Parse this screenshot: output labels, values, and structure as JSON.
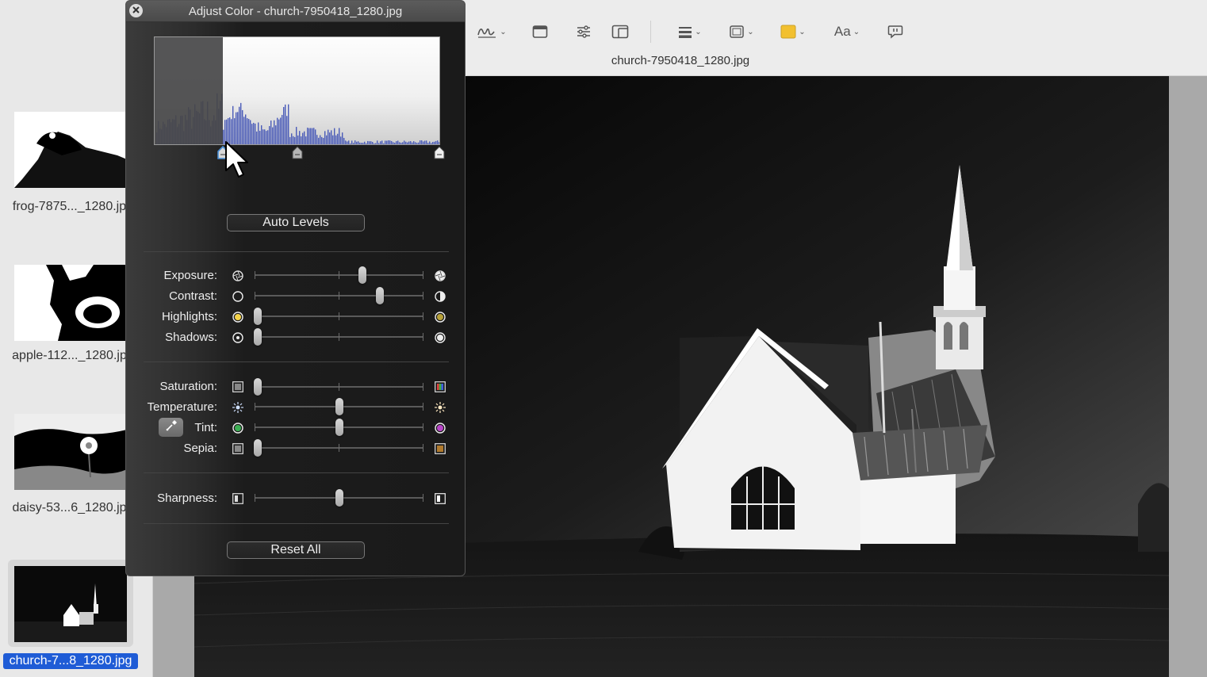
{
  "sidebar": {
    "items": [
      {
        "label": "frog-7875..._1280.jp",
        "selected": false
      },
      {
        "label": "apple-112..._1280.jp",
        "selected": false
      },
      {
        "label": "daisy-53...6_1280.jp",
        "selected": false
      },
      {
        "label": "church-7...8_1280.jpg",
        "selected": true
      }
    ]
  },
  "toolbar": {
    "doc_title": "church-7950418_1280.jpg",
    "text_style_label": "Aa",
    "fill_color": "#f2c02f",
    "icons": [
      "signature-icon",
      "window-icon",
      "adjust-sliders-icon",
      "crop-icon",
      "line-style-icon",
      "border-style-icon",
      "fill-color-icon",
      "text-style-icon",
      "speech-bubble-icon"
    ]
  },
  "adjust_panel": {
    "title": "Adjust Color - church-7950418_1280.jpg",
    "auto_levels_label": "Auto Levels",
    "reset_all_label": "Reset All",
    "levels": {
      "black_point": 0.24,
      "midpoint": 0.5,
      "white_point": 1.0
    },
    "sliders": [
      {
        "label": "Exposure:",
        "value": 0.64
      },
      {
        "label": "Contrast:",
        "value": 0.74
      },
      {
        "label": "Highlights:",
        "value": 0.02
      },
      {
        "label": "Shadows:",
        "value": 0.02
      },
      {
        "label": "Saturation:",
        "value": 0.02
      },
      {
        "label": "Temperature:",
        "value": 0.5
      },
      {
        "label": "Tint:",
        "value": 0.5
      },
      {
        "label": "Sepia:",
        "value": 0.02
      },
      {
        "label": "Sharpness:",
        "value": 0.5
      }
    ]
  }
}
